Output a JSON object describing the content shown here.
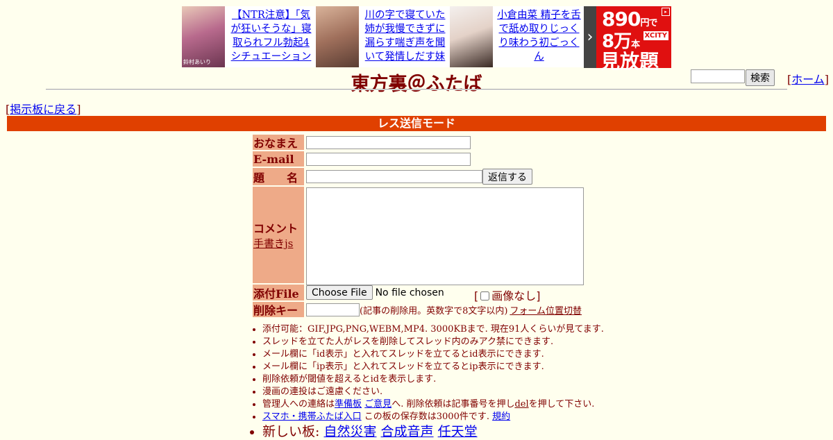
{
  "ads": [
    {
      "caption": "鈴村あいり",
      "text": "【NTR注意】「気が狂いそうな」寝取られフル勃起4シチュエーション"
    },
    {
      "caption": "",
      "text": "川の字で寝ていた姉が我慢できずに漏らす喘ぎ声を聞いて発情しだす妹"
    },
    {
      "caption": "",
      "text": "小倉由菜 精子を舌で舐め取りじっくり味わう初ごっくん"
    }
  ],
  "promo": {
    "price": "890",
    "unit_yen": "円で",
    "count": "8万",
    "count_unit": "本",
    "brand": "XCITY",
    "label": "見放題",
    "next_icon": "chevron-right-icon"
  },
  "header": {
    "title": "東方裏＠ふたば",
    "search_button": "検索",
    "home_link": "ホーム"
  },
  "nav": {
    "back_link": "掲示板に戻る"
  },
  "mode_bar": "レス送信モード",
  "form": {
    "name_label": "おなまえ",
    "email_label": "E-mail",
    "subject_label": "題　　名",
    "submit_button": "返信する",
    "comment_label": "コメント",
    "handwrite_link": "手書きjs",
    "file_label": "添付File",
    "choose_file_button": "Choose File",
    "no_file_text": "No file chosen",
    "no_image_label": "画像なし",
    "delkey_label": "削除キー",
    "delkey_hint": "(記事の削除用。英数字で8文字以内)",
    "form_position_link": "フォーム位置切替"
  },
  "notes": {
    "n1": "添付可能：GIF,JPG,PNG,WEBM,MP4. 3000KBまで. 現在91人くらいが見てます.",
    "n2": "スレッドを立てた人がレスを削除してスレッド内のみアク禁にできます.",
    "n3": "メール欄に「id表示」と入れてスレッドを立てるとid表示にできます.",
    "n4": "メール欄に「ip表示」と入れてスレッドを立てるとip表示にできます.",
    "n5": "削除依頼が閾値を超えるとidを表示します.",
    "n6": "漫画の連投はご遠慮ください.",
    "n7_pre": "管理人への連絡は",
    "n7_link1": "準備板",
    "n7_link2": "ご意見",
    "n7_mid": "へ. 削除依頼は記事番号を押し",
    "n7_link3": "del",
    "n7_post": "を押して下さい.",
    "n8_link1": "スマホ・携帯ふたば入口",
    "n8_mid": " この板の保存数は3000件です.",
    "n8_link2": "規約",
    "new_boards_label": "新しい板:",
    "new_boards": [
      "自然災害",
      "合成音声",
      "任天堂"
    ]
  }
}
